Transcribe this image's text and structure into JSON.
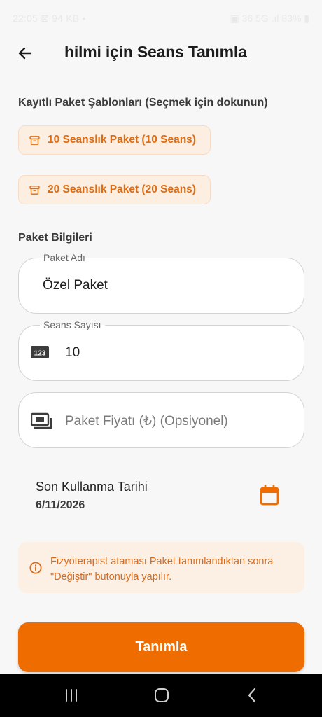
{
  "status_bar": {
    "time": "22:05 ⊠ 94 KB •",
    "right": "▣ 36 5G .ıl 83% ▮"
  },
  "header": {
    "title": "hilmi için Seans Tanımla"
  },
  "templates": {
    "label": "Kayıtlı Paket Şablonları (Seçmek için dokunun)",
    "items": [
      {
        "label": "10 Seanslık Paket (10 Seans)"
      },
      {
        "label": "20 Seanslık Paket (20 Seans)"
      }
    ]
  },
  "package_info": {
    "label": "Paket Bilgileri",
    "name_field": {
      "label": "Paket Adı",
      "value": "Özel Paket"
    },
    "sessions_field": {
      "label": "Seans Sayısı",
      "value": "10",
      "icon": "123-icon"
    },
    "price_field": {
      "placeholder": "Paket Fiyatı (₺) (Opsiyonel)",
      "icon": "money-icon"
    }
  },
  "expiry": {
    "label": "Son Kullanma Tarihi",
    "value": "6/11/2026",
    "icon": "calendar-icon"
  },
  "info": {
    "text": "Fizyoterapist ataması Paket tanımlandıktan sonra \"Değiştir\" butonuyla yapılır."
  },
  "actions": {
    "submit_label": "Tanımla"
  },
  "colors": {
    "accent": "#ef6c00",
    "chip_bg": "#fdeee2",
    "chip_text": "#e06c12",
    "info_bg": "#fcefe4"
  }
}
